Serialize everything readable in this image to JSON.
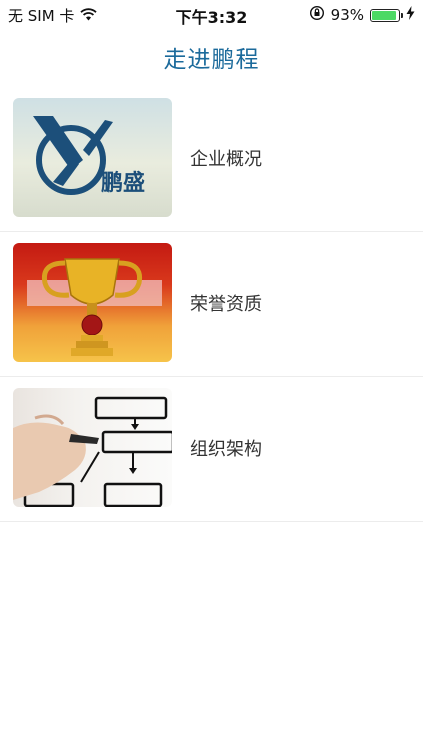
{
  "status_bar": {
    "carrier": "无 SIM 卡",
    "time": "下午3:32",
    "battery_percent": "93%",
    "battery_level": 0.93,
    "icons": [
      "wifi-icon",
      "rotation-lock-icon",
      "battery-icon",
      "charging-bolt-icon"
    ]
  },
  "nav": {
    "title": "走进鹏程"
  },
  "list": {
    "items": [
      {
        "label": "企业概况",
        "thumbnail": "company-logo",
        "logo_text": "鹏盛"
      },
      {
        "label": "荣誉资质",
        "thumbnail": "trophy"
      },
      {
        "label": "组织架构",
        "thumbnail": "org-chart"
      }
    ]
  },
  "colors": {
    "title": "#1b6a9b",
    "battery_fill": "#4cd964",
    "logo_blue": "#1c4f7a"
  }
}
